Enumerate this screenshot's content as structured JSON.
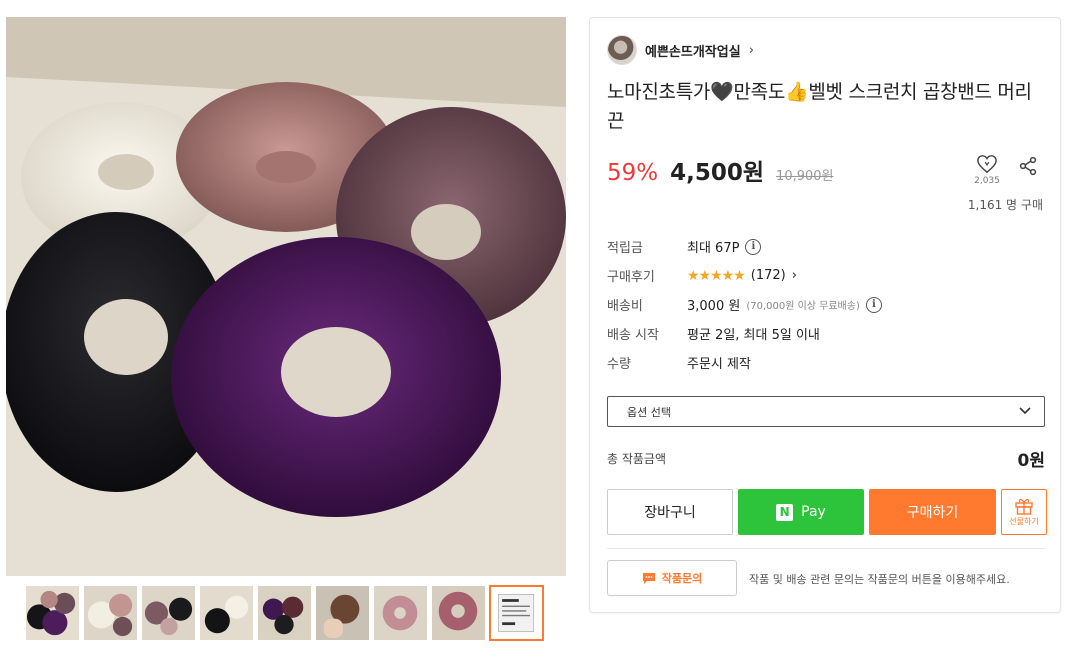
{
  "gallery": {
    "main_alt": "velvet scrunchies product photo",
    "thumbnail_count": 9,
    "active_thumbnail_index": 8
  },
  "seller": {
    "name": "예쁜손뜨개작업실",
    "chevron": "›"
  },
  "product": {
    "title_part1": "노마진초특가",
    "title_part2": "만족도",
    "title_part3": "벨벳 스크런치 곱창밴드 머리끈",
    "heart_emoji": "🖤",
    "thumb_emoji": "👍"
  },
  "price": {
    "discount": "59%",
    "current": "4,500원",
    "original": "10,900원"
  },
  "likes": {
    "count": "2,035"
  },
  "purchase_count": "1,161 명 구매",
  "info": {
    "points_label": "적립금",
    "points_value": "최대 67P",
    "review_label": "구매후기",
    "review_count": "(172)",
    "review_stars": "★★★★★",
    "shipping_label": "배송비",
    "shipping_value": "3,000 원",
    "shipping_sub": "(70,000원 이상 무료배송)",
    "ship_start_label": "배송 시작",
    "ship_start_value": "평균 2일, 최대 5일 이내",
    "quantity_label": "수량",
    "quantity_value": "주문시 제작"
  },
  "option_select": {
    "placeholder": "옵션 선택"
  },
  "total": {
    "label": "총 작품금액",
    "value": "0원"
  },
  "buttons": {
    "cart": "장바구니",
    "npay_logo": "N",
    "npay": "Pay",
    "buy": "구매하기",
    "gift": "선물하기"
  },
  "inquiry": {
    "button": "작품문의",
    "note": "작품 및 배송 관련 문의는 작품문의 버튼을 이용해주세요."
  },
  "colors": {
    "accent": "#ff7a2f",
    "discount": "#ee3a3a",
    "npay": "#2dc43b"
  },
  "icons": {
    "heart": "heart-outline-icon",
    "share": "share-icon",
    "info": "info-circle-icon",
    "chevron_down": "chevron-down-icon",
    "gift": "gift-icon",
    "chat": "chat-bubble-icon"
  }
}
